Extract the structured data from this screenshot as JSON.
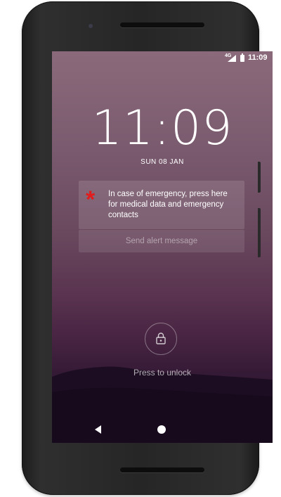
{
  "status_bar": {
    "network": "4G",
    "time": "11:09"
  },
  "lockscreen": {
    "clock": "11:09",
    "date": "SUN 08 JAN"
  },
  "emergency": {
    "icon": "medical-asterisk-icon",
    "icon_color": "#e21c1c",
    "message": "In case of emergency, press here for medical data and emergency contacts",
    "alert_button_label": "Send alert message"
  },
  "unlock": {
    "icon": "lock-icon",
    "label": "Press to unlock"
  },
  "navigation": {
    "back_icon": "back-triangle-icon",
    "home_icon": "home-circle-icon"
  }
}
